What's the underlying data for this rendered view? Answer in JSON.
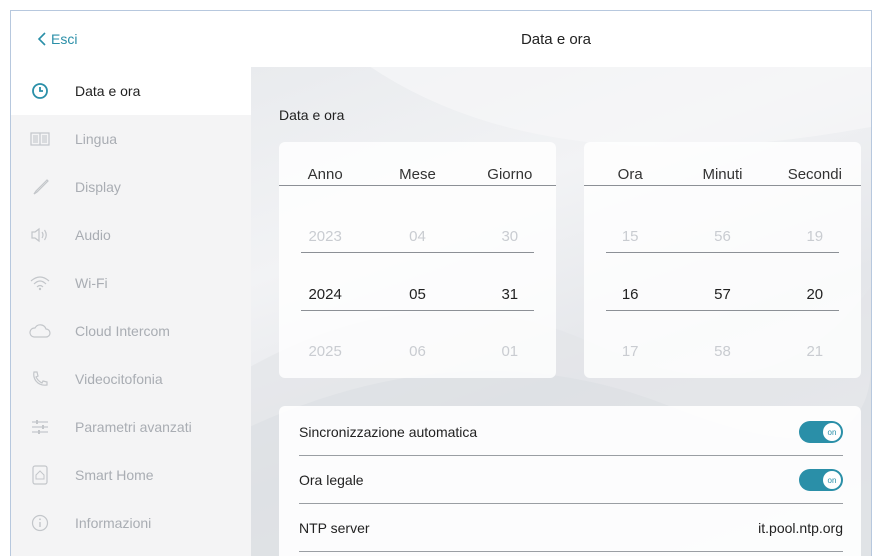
{
  "header": {
    "back_label": "Esci",
    "title": "Data e ora"
  },
  "sidebar": {
    "items": [
      {
        "label": "Data e ora",
        "icon": "clock-icon",
        "active": true
      },
      {
        "label": "Lingua",
        "icon": "book-icon",
        "active": false
      },
      {
        "label": "Display",
        "icon": "brush-icon",
        "active": false
      },
      {
        "label": "Audio",
        "icon": "speaker-icon",
        "active": false
      },
      {
        "label": "Wi-Fi",
        "icon": "wifi-icon",
        "active": false
      },
      {
        "label": "Cloud Intercom",
        "icon": "cloud-icon",
        "active": false
      },
      {
        "label": "Videocitofonia",
        "icon": "phone-icon",
        "active": false
      },
      {
        "label": "Parametri avanzati",
        "icon": "sliders-icon",
        "active": false
      },
      {
        "label": "Smart Home",
        "icon": "home-icon",
        "active": false
      },
      {
        "label": "Informazioni",
        "icon": "info-icon",
        "active": false
      }
    ]
  },
  "main": {
    "section_label": "Data e ora",
    "date_picker": {
      "headers": [
        "Anno",
        "Mese",
        "Giorno"
      ],
      "prev": [
        "2023",
        "04",
        "30"
      ],
      "selected": [
        "2024",
        "05",
        "31"
      ],
      "next": [
        "2025",
        "06",
        "01"
      ]
    },
    "time_picker": {
      "headers": [
        "Ora",
        "Minuti",
        "Secondi"
      ],
      "prev": [
        "15",
        "56",
        "19"
      ],
      "selected": [
        "16",
        "57",
        "20"
      ],
      "next": [
        "17",
        "58",
        "21"
      ]
    },
    "settings": {
      "auto_sync_label": "Sincronizzazione automatica",
      "auto_sync_state": "on",
      "dst_label": "Ora legale",
      "dst_state": "on",
      "ntp_label": "NTP server",
      "ntp_value": "it.pool.ntp.org"
    }
  },
  "colors": {
    "accent": "#2a8fa8",
    "sidebar_bg": "#f4f4f5",
    "inactive_text": "#a9adb3"
  }
}
